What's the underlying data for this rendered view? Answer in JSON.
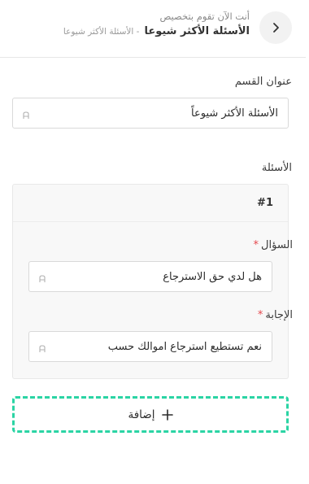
{
  "header": {
    "subtitle": "أنت الآن تقوم بتخصيص",
    "title": "الأسئلة الأكثر شيوعا",
    "breadcrumb": "- الأسئلة الأكثر شيوعا",
    "back_icon": "chevron-right-icon"
  },
  "section": {
    "label": "عنوان القسم",
    "value": "الأسئلة الأكثر شيوعاً",
    "icon": "input-type-icon"
  },
  "questions": {
    "label": "الأسئلة",
    "items": [
      {
        "number": "#1",
        "question_label": "السؤال",
        "question_value": "هل لدي حق الاسترجاع",
        "answer_label": "الإجابة",
        "answer_value": "نعم تستطيع استرجاع اموالك حسب",
        "required_mark": "*"
      }
    ]
  },
  "add_button": {
    "label": "إضافة",
    "icon": "plus-icon",
    "border_color": "#2bd4a4"
  }
}
